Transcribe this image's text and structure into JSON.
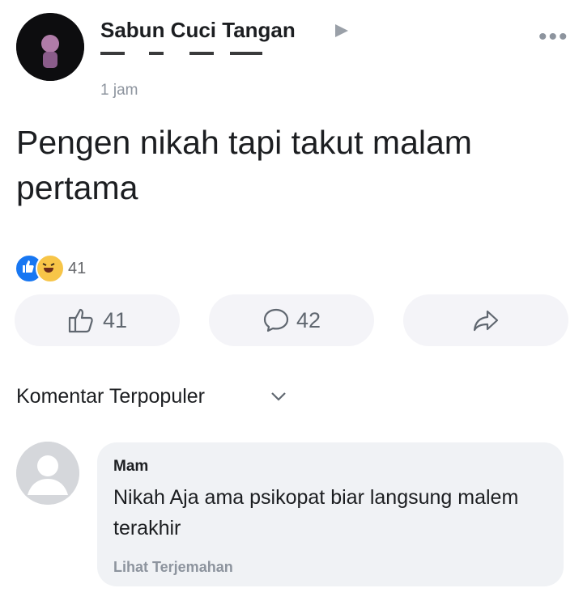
{
  "post": {
    "author": "Sabun Cuci Tangan",
    "timestamp": "1 jam",
    "text": "Pengen nikah tapi takut malam pertama",
    "reaction_count": "41"
  },
  "actions": {
    "like_count": "41",
    "comment_count": "42"
  },
  "comments_section": {
    "sort_label": "Komentar Terpopuler",
    "comment": {
      "author": "Mam",
      "text": "Nikah Aja ama psikopat biar langsung malem terakhir",
      "translate_label": "Lihat Terjemahan"
    }
  },
  "icons": {
    "more": "more-horizontal-icon",
    "like": "thumbs-up-icon",
    "comment": "comment-bubble-icon",
    "share": "share-arrow-icon",
    "sort": "chevron-down-icon"
  },
  "colors": {
    "like_blue": "#1877f2",
    "haha_yellow": "#f7c548",
    "secondary_text": "#8d949e",
    "bubble_bg": "#f0f2f5"
  }
}
